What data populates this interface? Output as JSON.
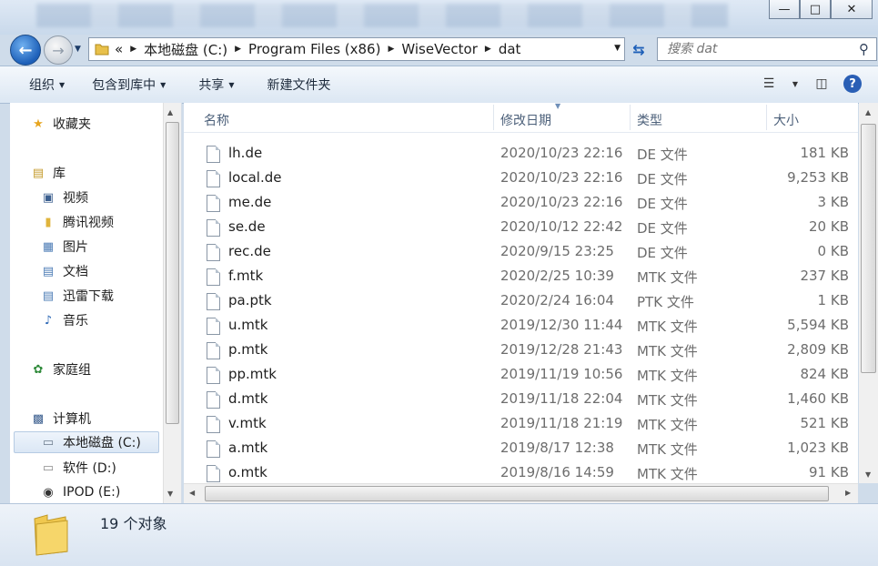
{
  "window": {
    "min_icon": "minimize-icon",
    "max_icon": "maximize-icon",
    "close_icon": "close-icon"
  },
  "address": {
    "prefix": "«",
    "crumbs": [
      "本地磁盘 (C:)",
      "Program Files (x86)",
      "WiseVector",
      "dat"
    ]
  },
  "search": {
    "placeholder": "搜索 dat"
  },
  "toolbar": {
    "organize": "组织",
    "include": "包含到库中",
    "share": "共享",
    "new_folder": "新建文件夹"
  },
  "nav": {
    "favorites": "收藏夹",
    "library": "库",
    "videos": "视频",
    "tencent_video": "腾讯视频",
    "pictures": "图片",
    "documents": "文档",
    "thunder": "迅雷下载",
    "music": "音乐",
    "homegroup": "家庭组",
    "computer": "计算机",
    "drive_c": "本地磁盘 (C:)",
    "drive_d": "软件 (D:)",
    "drive_e": "IPOD (E:)"
  },
  "columns": {
    "name": "名称",
    "date": "修改日期",
    "type": "类型",
    "size": "大小"
  },
  "files": [
    {
      "name": "lh.de",
      "date": "2020/10/23 22:16",
      "type": "DE 文件",
      "size": "181 KB"
    },
    {
      "name": "local.de",
      "date": "2020/10/23 22:16",
      "type": "DE 文件",
      "size": "9,253 KB"
    },
    {
      "name": "me.de",
      "date": "2020/10/23 22:16",
      "type": "DE 文件",
      "size": "3 KB"
    },
    {
      "name": "se.de",
      "date": "2020/10/12 22:42",
      "type": "DE 文件",
      "size": "20 KB"
    },
    {
      "name": "rec.de",
      "date": "2020/9/15 23:25",
      "type": "DE 文件",
      "size": "0 KB"
    },
    {
      "name": "f.mtk",
      "date": "2020/2/25 10:39",
      "type": "MTK 文件",
      "size": "237 KB"
    },
    {
      "name": "pa.ptk",
      "date": "2020/2/24 16:04",
      "type": "PTK 文件",
      "size": "1 KB"
    },
    {
      "name": "u.mtk",
      "date": "2019/12/30 11:44",
      "type": "MTK 文件",
      "size": "5,594 KB"
    },
    {
      "name": "p.mtk",
      "date": "2019/12/28 21:43",
      "type": "MTK 文件",
      "size": "2,809 KB"
    },
    {
      "name": "pp.mtk",
      "date": "2019/11/19 10:56",
      "type": "MTK 文件",
      "size": "824 KB"
    },
    {
      "name": "d.mtk",
      "date": "2019/11/18 22:04",
      "type": "MTK 文件",
      "size": "1,460 KB"
    },
    {
      "name": "v.mtk",
      "date": "2019/11/18 21:19",
      "type": "MTK 文件",
      "size": "521 KB"
    },
    {
      "name": "a.mtk",
      "date": "2019/8/17 12:38",
      "type": "MTK 文件",
      "size": "1,023 KB"
    },
    {
      "name": "o.mtk",
      "date": "2019/8/16 14:59",
      "type": "MTK 文件",
      "size": "91 KB"
    }
  ],
  "status": {
    "count": "19 个对象"
  }
}
